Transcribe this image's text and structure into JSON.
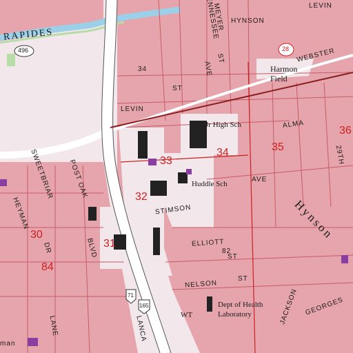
{
  "colors": {
    "urban": "#e6a5ac",
    "urban_light": "#f2e7ea",
    "water": "#9bd0e8",
    "road": "#ffffff",
    "street_line": "#c85a66",
    "section_line": "#cc1f1f",
    "building": "#222222",
    "green": "#b7dca8",
    "purple": "#8a3fa0"
  },
  "water_label": "RAPIDES",
  "streets": {
    "tennessee": "TENNESSEE",
    "ave_top": "AVE",
    "meyer": "MEYER",
    "hynson_top": "HYNSON",
    "st_top1": "ST",
    "levin_top": "LEVIN",
    "webster": "WEBSTER",
    "levin": "LEVIN",
    "st_levin": "ST",
    "alma": "ALMA",
    "twentyninth": "29TH",
    "ave_huddle": "AVE",
    "hynson_diag": "Hynson",
    "stimson": "STIMSON",
    "elliott": "ELLIOTT",
    "nelson": "NELSON",
    "st_nelson": "ST",
    "jackson": "JACKSON",
    "georges": "GEORGES",
    "post_oak": "POST OAK",
    "blvd": "BLVD",
    "sweetbriar": "SWEETBRIAR",
    "dr": "DR",
    "heyman": "HEYMAN",
    "lane": "LANE",
    "lancaster": "LANCA",
    "man": "man",
    "st_misc": "ST",
    "num_84_street": "84",
    "num_82_street": "82",
    "num_34_street": "34"
  },
  "features": {
    "harmon_field": [
      "Harmon",
      "Field"
    ],
    "jr_high": "Jr High Sch",
    "huddle": "Huddle Sch",
    "dept_health": [
      "Dept of Health",
      "Laboratory"
    ],
    "wt": "WT"
  },
  "sections": [
    "33",
    "34",
    "35",
    "36",
    "32",
    "30",
    "31",
    "84"
  ],
  "shields": {
    "route_496": "496",
    "route_28": "28",
    "route_71": "71",
    "route_165": "165"
  }
}
